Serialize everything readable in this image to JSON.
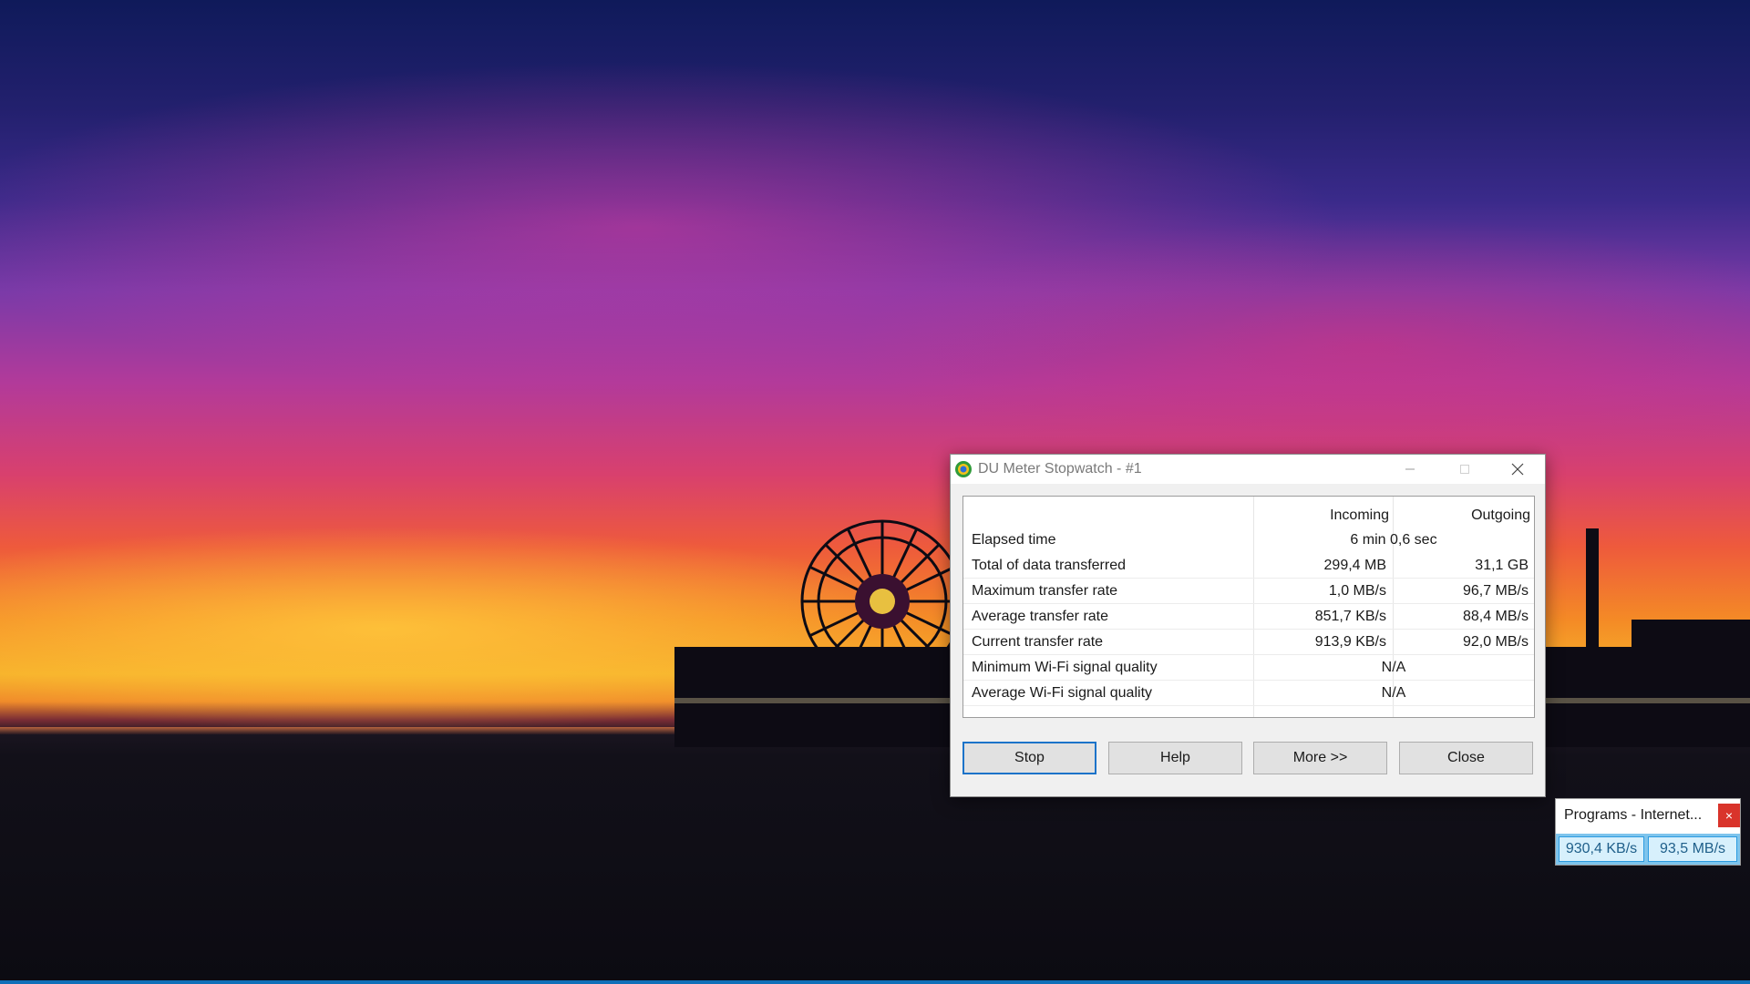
{
  "window": {
    "title": "DU Meter Stopwatch - #1",
    "icon": "du-meter-app-icon"
  },
  "stats": {
    "columns": {
      "incoming": "Incoming",
      "outgoing": "Outgoing"
    },
    "rows": [
      {
        "label": "Elapsed time",
        "value": "6 min 0,6 sec"
      },
      {
        "label": "Total of data transferred",
        "incoming": "299,4 MB",
        "outgoing": "31,1 GB"
      },
      {
        "label": "Maximum transfer rate",
        "incoming": "1,0 MB/s",
        "outgoing": "96,7 MB/s"
      },
      {
        "label": "Average transfer rate",
        "incoming": "851,7 KB/s",
        "outgoing": "88,4 MB/s"
      },
      {
        "label": "Current transfer rate",
        "incoming": "913,9 KB/s",
        "outgoing": "92,0 MB/s"
      },
      {
        "label": "Minimum Wi-Fi signal quality",
        "value": "N/A"
      },
      {
        "label": "Average Wi-Fi signal quality",
        "value": "N/A"
      }
    ]
  },
  "buttons": {
    "stop": "Stop",
    "help": "Help",
    "more": "More >>",
    "close": "Close"
  },
  "mini_meter": {
    "title": "Programs - Internet...",
    "close_glyph": "×",
    "incoming_rate": "930,4 KB/s",
    "outgoing_rate": "93,5 MB/s"
  },
  "colors": {
    "accent": "#1c73c9",
    "mini_close": "#d9342b",
    "mini_bar": "#7ec4ec"
  }
}
